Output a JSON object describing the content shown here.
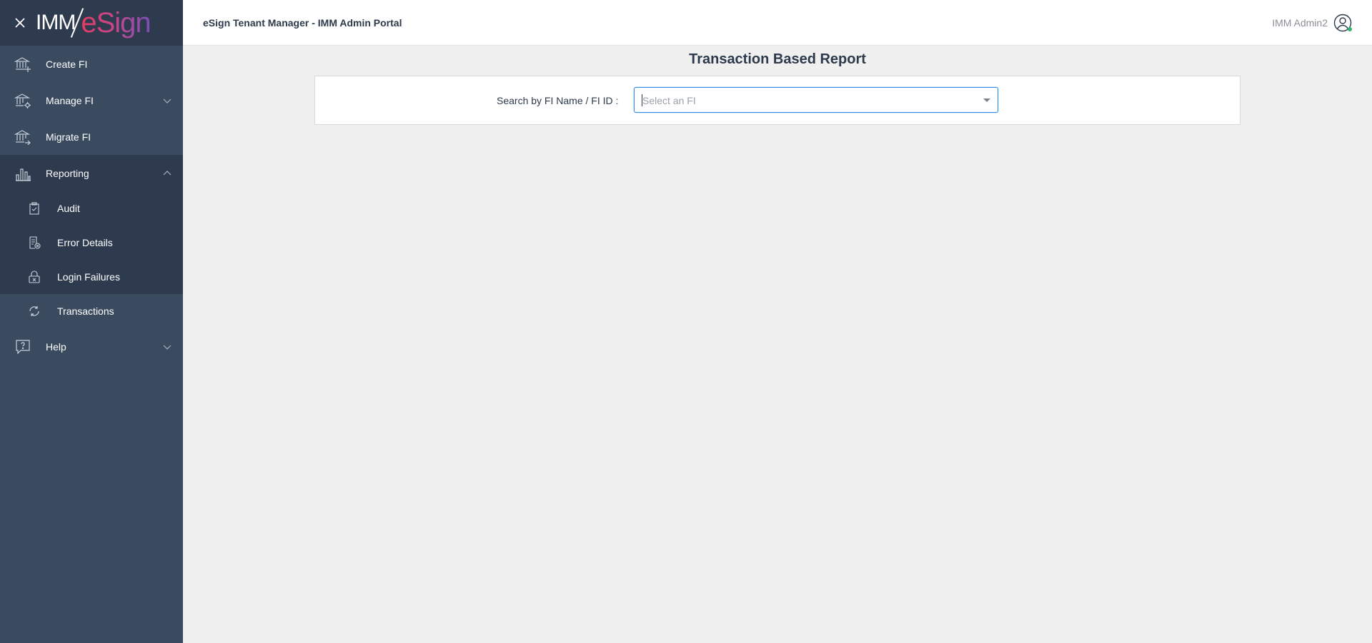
{
  "brand": {
    "logo_left": "IMM",
    "logo_right": "eSign"
  },
  "header": {
    "title": "eSign Tenant Manager - IMM Admin Portal",
    "user_name": "IMM Admin2"
  },
  "sidebar": {
    "items": [
      {
        "label": "Create FI",
        "icon": "bank-plus-icon"
      },
      {
        "label": "Manage FI",
        "icon": "bank-gear-icon"
      },
      {
        "label": "Migrate FI",
        "icon": "bank-arrow-icon"
      },
      {
        "label": "Reporting",
        "icon": "bar-chart-icon"
      },
      {
        "label": "Help",
        "icon": "help-bubble-icon"
      }
    ],
    "reporting_sub": [
      {
        "label": "Audit",
        "icon": "clipboard-check-icon"
      },
      {
        "label": "Error Details",
        "icon": "document-error-icon"
      },
      {
        "label": "Login Failures",
        "icon": "lock-x-icon"
      },
      {
        "label": "Transactions",
        "icon": "sync-icon"
      }
    ],
    "active_item": "Transactions"
  },
  "main": {
    "page_title": "Transaction Based Report",
    "search_label": "Search by FI Name / FI ID :",
    "select_placeholder": "Select an FI"
  },
  "colors": {
    "sidebar_bg": "#3a4a5f",
    "sidebar_dark": "#2e3b4e",
    "focus_border": "#2d8ce3",
    "status_online": "#2fb673"
  }
}
